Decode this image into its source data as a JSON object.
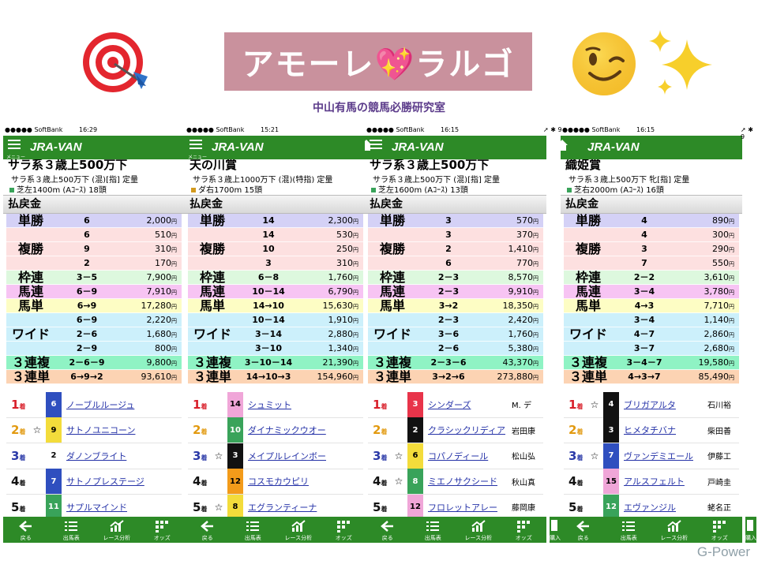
{
  "header": {
    "title": "アモーレ💖ラルゴ",
    "subtitle": "中山有馬の競馬必勝研究室",
    "left_emoji": "🎯",
    "right_emoji": "😉",
    "sparkles": "✨",
    "credit": "G-Power"
  },
  "common": {
    "logo": "JRA-VAN",
    "menu_label": "メニュー",
    "top_label": "トップ",
    "payout_header": "払戻金",
    "yen": "円",
    "tabs": [
      "戻る",
      "出馬表",
      "レース分析",
      "オッズ",
      "購入"
    ]
  },
  "colors": {
    "green": "#2d8a27",
    "tansho": "#d4d1f6",
    "fukusho": "#fde0e0",
    "wakuren": "#ddf8de",
    "umaren": "#f7c4f3",
    "umatan": "#fdfdc4",
    "wide": "#ccf0fb",
    "sanrenpuku": "#8ff3c4",
    "sanrentan": "#fcd3b3",
    "frame": [
      "#ffffff",
      "#ffffff",
      "#111111",
      "#e8344a",
      "#2f4fbf",
      "#f3dc3b",
      "#39a35a",
      "#f39b1a",
      "#f0a6d8"
    ]
  },
  "panels": [
    {
      "carrier": "●●●●● SoftBank",
      "time": "16:29",
      "battery": "",
      "race_name": "サラ系３歳上500万下",
      "race_cond": "サラ系３歳上500万下 (混)[指] 定量",
      "race_dist": "芝左1400m (Aｺｰｽ) 18頭",
      "dist_color": "#39a35a",
      "payouts": [
        {
          "type": "単勝",
          "rows": [
            [
              "6",
              "2,000"
            ]
          ]
        },
        {
          "type": "複勝",
          "rows": [
            [
              "6",
              "510"
            ],
            [
              "9",
              "310"
            ],
            [
              "2",
              "170"
            ]
          ]
        },
        {
          "type": "枠連",
          "rows": [
            [
              "3－5",
              "7,900"
            ]
          ]
        },
        {
          "type": "馬連",
          "rows": [
            [
              "6－9",
              "7,910"
            ]
          ]
        },
        {
          "type": "馬単",
          "rows": [
            [
              "6→9",
              "17,280"
            ]
          ]
        },
        {
          "type": "ワイド",
          "rows": [
            [
              "6－9",
              "2,220"
            ],
            [
              "2－6",
              "1,680"
            ],
            [
              "2－9",
              "800"
            ]
          ]
        },
        {
          "type": "３連複",
          "rows": [
            [
              "2－6－9",
              "9,800"
            ]
          ]
        },
        {
          "type": "３連単",
          "rows": [
            [
              "6→9→2",
              "93,610"
            ]
          ]
        }
      ],
      "results": [
        {
          "rank": "1",
          "mark": "",
          "num": "6",
          "frame": 4,
          "horse": "ノーブルルージュ",
          "jockey": ""
        },
        {
          "rank": "2",
          "mark": "☆",
          "num": "9",
          "frame": 5,
          "horse": "サトノユニコーン",
          "jockey": ""
        },
        {
          "rank": "3",
          "mark": "",
          "num": "2",
          "frame": 1,
          "horse": "ダノンブライト",
          "jockey": ""
        },
        {
          "rank": "4",
          "mark": "",
          "num": "7",
          "frame": 4,
          "horse": "サトノプレステージ",
          "jockey": ""
        },
        {
          "rank": "5",
          "mark": "",
          "num": "11",
          "frame": 6,
          "horse": "サプルマインド",
          "jockey": ""
        }
      ]
    },
    {
      "carrier": "●●●●● SoftBank",
      "time": "15:21",
      "battery": "",
      "race_name": "天の川賞",
      "race_cond": "サラ系３歳上1000万下 (混)(特指) 定量",
      "race_dist": "ダ右1700m 15頭",
      "dist_color": "#d39a1e",
      "payouts": [
        {
          "type": "単勝",
          "rows": [
            [
              "14",
              "2,300"
            ]
          ]
        },
        {
          "type": "複勝",
          "rows": [
            [
              "14",
              "530"
            ],
            [
              "10",
              "250"
            ],
            [
              "3",
              "310"
            ]
          ]
        },
        {
          "type": "枠連",
          "rows": [
            [
              "6－8",
              "1,760"
            ]
          ]
        },
        {
          "type": "馬連",
          "rows": [
            [
              "10－14",
              "6,790"
            ]
          ]
        },
        {
          "type": "馬単",
          "rows": [
            [
              "14→10",
              "15,630"
            ]
          ]
        },
        {
          "type": "ワイド",
          "rows": [
            [
              "10－14",
              "1,910"
            ],
            [
              "3－14",
              "2,880"
            ],
            [
              "3－10",
              "1,340"
            ]
          ]
        },
        {
          "type": "３連複",
          "rows": [
            [
              "3－10－14",
              "21,390"
            ]
          ]
        },
        {
          "type": "３連単",
          "rows": [
            [
              "14→10→3",
              "154,960"
            ]
          ]
        }
      ],
      "results": [
        {
          "rank": "1",
          "mark": "",
          "num": "14",
          "frame": 8,
          "horse": "シュミット",
          "jockey": ""
        },
        {
          "rank": "2",
          "mark": "",
          "num": "10",
          "frame": 6,
          "horse": "ダイナミックウオー",
          "jockey": ""
        },
        {
          "rank": "3",
          "mark": "☆",
          "num": "3",
          "frame": 2,
          "horse": "メイプルレインボー",
          "jockey": ""
        },
        {
          "rank": "4",
          "mark": "",
          "num": "12",
          "frame": 7,
          "horse": "コスモカウピリ",
          "jockey": ""
        },
        {
          "rank": "5",
          "mark": "☆",
          "num": "8",
          "frame": 5,
          "horse": "エグランティーナ",
          "jockey": ""
        }
      ]
    },
    {
      "carrier": "●●●●● SoftBank",
      "time": "16:15",
      "battery": "",
      "race_name": "サラ系３歳上500万下",
      "race_cond": "サラ系３歳上500万下 (混)[指] 定量",
      "race_dist": "芝左1600m (Aｺｰｽ) 13頭",
      "dist_color": "#39a35a",
      "payouts": [
        {
          "type": "単勝",
          "rows": [
            [
              "3",
              "570"
            ]
          ]
        },
        {
          "type": "複勝",
          "rows": [
            [
              "3",
              "370"
            ],
            [
              "2",
              "1,410"
            ],
            [
              "6",
              "770"
            ]
          ]
        },
        {
          "type": "枠連",
          "rows": [
            [
              "2－3",
              "8,570"
            ]
          ]
        },
        {
          "type": "馬連",
          "rows": [
            [
              "2－3",
              "9,910"
            ]
          ]
        },
        {
          "type": "馬単",
          "rows": [
            [
              "3→2",
              "18,350"
            ]
          ]
        },
        {
          "type": "ワイド",
          "rows": [
            [
              "2－3",
              "2,420"
            ],
            [
              "3－6",
              "1,760"
            ],
            [
              "2－6",
              "5,380"
            ]
          ]
        },
        {
          "type": "３連複",
          "rows": [
            [
              "2－3－6",
              "43,370"
            ]
          ]
        },
        {
          "type": "３連単",
          "rows": [
            [
              "3→2→6",
              "273,880"
            ]
          ]
        }
      ],
      "results": [
        {
          "rank": "1",
          "mark": "",
          "num": "3",
          "frame": 3,
          "horse": "シンダーズ",
          "jockey": "M. デ"
        },
        {
          "rank": "2",
          "mark": "",
          "num": "2",
          "frame": 2,
          "horse": "クラシックリディア",
          "jockey": "岩田康"
        },
        {
          "rank": "3",
          "mark": "☆",
          "num": "6",
          "frame": 5,
          "horse": "コパノディール",
          "jockey": "松山弘"
        },
        {
          "rank": "4",
          "mark": "☆",
          "num": "8",
          "frame": 6,
          "horse": "ミエノサクシード",
          "jockey": "秋山真"
        },
        {
          "rank": "5",
          "mark": "",
          "num": "12",
          "frame": 8,
          "horse": "フロレットアレー",
          "jockey": "藤岡康"
        }
      ]
    },
    {
      "carrier": "●●●●● SoftBank",
      "time": "16:15",
      "battery": "",
      "race_name": "織姫賞",
      "race_cond": "サラ系３歳上500万下 牝[指] 定量",
      "race_dist": "芝右2000m (Aｺｰｽ) 16頭",
      "dist_color": "#39a35a",
      "payouts": [
        {
          "type": "単勝",
          "rows": [
            [
              "4",
              "890"
            ]
          ]
        },
        {
          "type": "複勝",
          "rows": [
            [
              "4",
              "300"
            ],
            [
              "3",
              "290"
            ],
            [
              "7",
              "550"
            ]
          ]
        },
        {
          "type": "枠連",
          "rows": [
            [
              "2－2",
              "3,610"
            ]
          ]
        },
        {
          "type": "馬連",
          "rows": [
            [
              "3－4",
              "3,780"
            ]
          ]
        },
        {
          "type": "馬単",
          "rows": [
            [
              "4→3",
              "7,710"
            ]
          ]
        },
        {
          "type": "ワイド",
          "rows": [
            [
              "3－4",
              "1,140"
            ],
            [
              "4－7",
              "2,860"
            ],
            [
              "3－7",
              "2,680"
            ]
          ]
        },
        {
          "type": "３連複",
          "rows": [
            [
              "3－4－7",
              "19,580"
            ]
          ]
        },
        {
          "type": "３連単",
          "rows": [
            [
              "4→3→7",
              "85,490"
            ]
          ]
        }
      ],
      "results": [
        {
          "rank": "1",
          "mark": "☆",
          "num": "4",
          "frame": 2,
          "horse": "ブリガアルタ",
          "jockey": "石川裕"
        },
        {
          "rank": "2",
          "mark": "",
          "num": "3",
          "frame": 2,
          "horse": "ヒメタチバナ",
          "jockey": "柴田善"
        },
        {
          "rank": "3",
          "mark": "☆",
          "num": "7",
          "frame": 4,
          "horse": "ヴァンデミエール",
          "jockey": "伊藤工"
        },
        {
          "rank": "4",
          "mark": "",
          "num": "15",
          "frame": 8,
          "horse": "アルスフェルト",
          "jockey": "戸崎圭"
        },
        {
          "rank": "5",
          "mark": "",
          "num": "12",
          "frame": 6,
          "horse": "エヴァンジル",
          "jockey": "蛯名正"
        }
      ]
    }
  ]
}
